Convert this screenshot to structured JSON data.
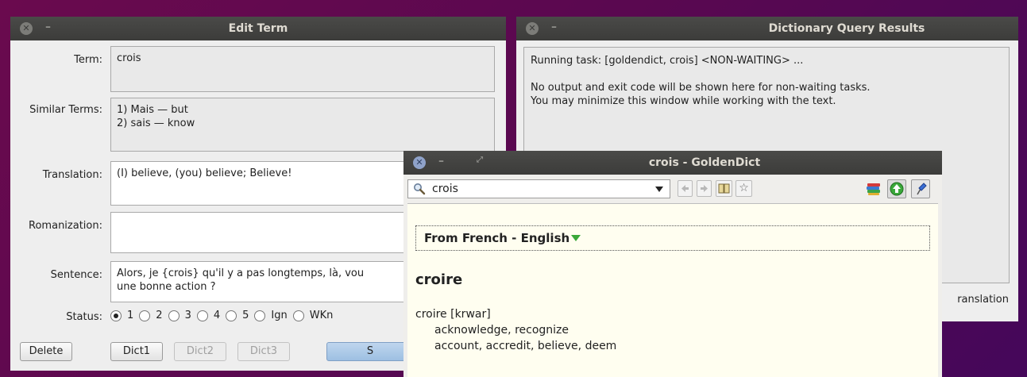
{
  "edit_term": {
    "title": "Edit Term",
    "term_label": "Term:",
    "term_value": "crois",
    "similar_label": "Similar Terms:",
    "similar_value": "1) Mais — but\n2) sais — know",
    "translation_label": "Translation:",
    "translation_value": "(I) believe, (you) believe; Believe!",
    "romanization_label": "Romanization:",
    "romanization_value": "",
    "sentence_label": "Sentence:",
    "sentence_value": "Alors, je {crois} qu'il y a pas longtemps, là, vou\nune bonne action ?",
    "status_label": "Status:",
    "status_options": [
      "1",
      "2",
      "3",
      "4",
      "5",
      "Ign",
      "WKn"
    ],
    "status_selected": "1",
    "buttons": {
      "delete": "Delete",
      "dict1": "Dict1",
      "dict2": "Dict2",
      "dict3": "Dict3",
      "save": "S"
    }
  },
  "dictionary_results": {
    "title": "Dictionary Query Results",
    "lines": "Running task: [goldendict, crois] <NON-WAITING> ...\n\nNo output and exit code will be shown here for non-waiting tasks.\nYou may minimize this window while working with the text.",
    "partial_button": "ranslation"
  },
  "goldendict": {
    "title": "crois - GoldenDict",
    "search_value": "crois",
    "dict_header": "From French - English",
    "headword": "croire",
    "entry_line": "croire [krwar]",
    "definitions": [
      "acknowledge, recognize",
      "account, accredit, believe, deem"
    ],
    "icons": {
      "search": "magnifier-icon",
      "dropdown": "dropdown-arrow-icon",
      "back": "back-icon",
      "forward": "forward-icon",
      "book": "book-icon",
      "star": "star-icon",
      "dictionaries": "dictionaries-icon",
      "scan": "green-arrow-icon",
      "pin": "pin-icon"
    }
  }
}
